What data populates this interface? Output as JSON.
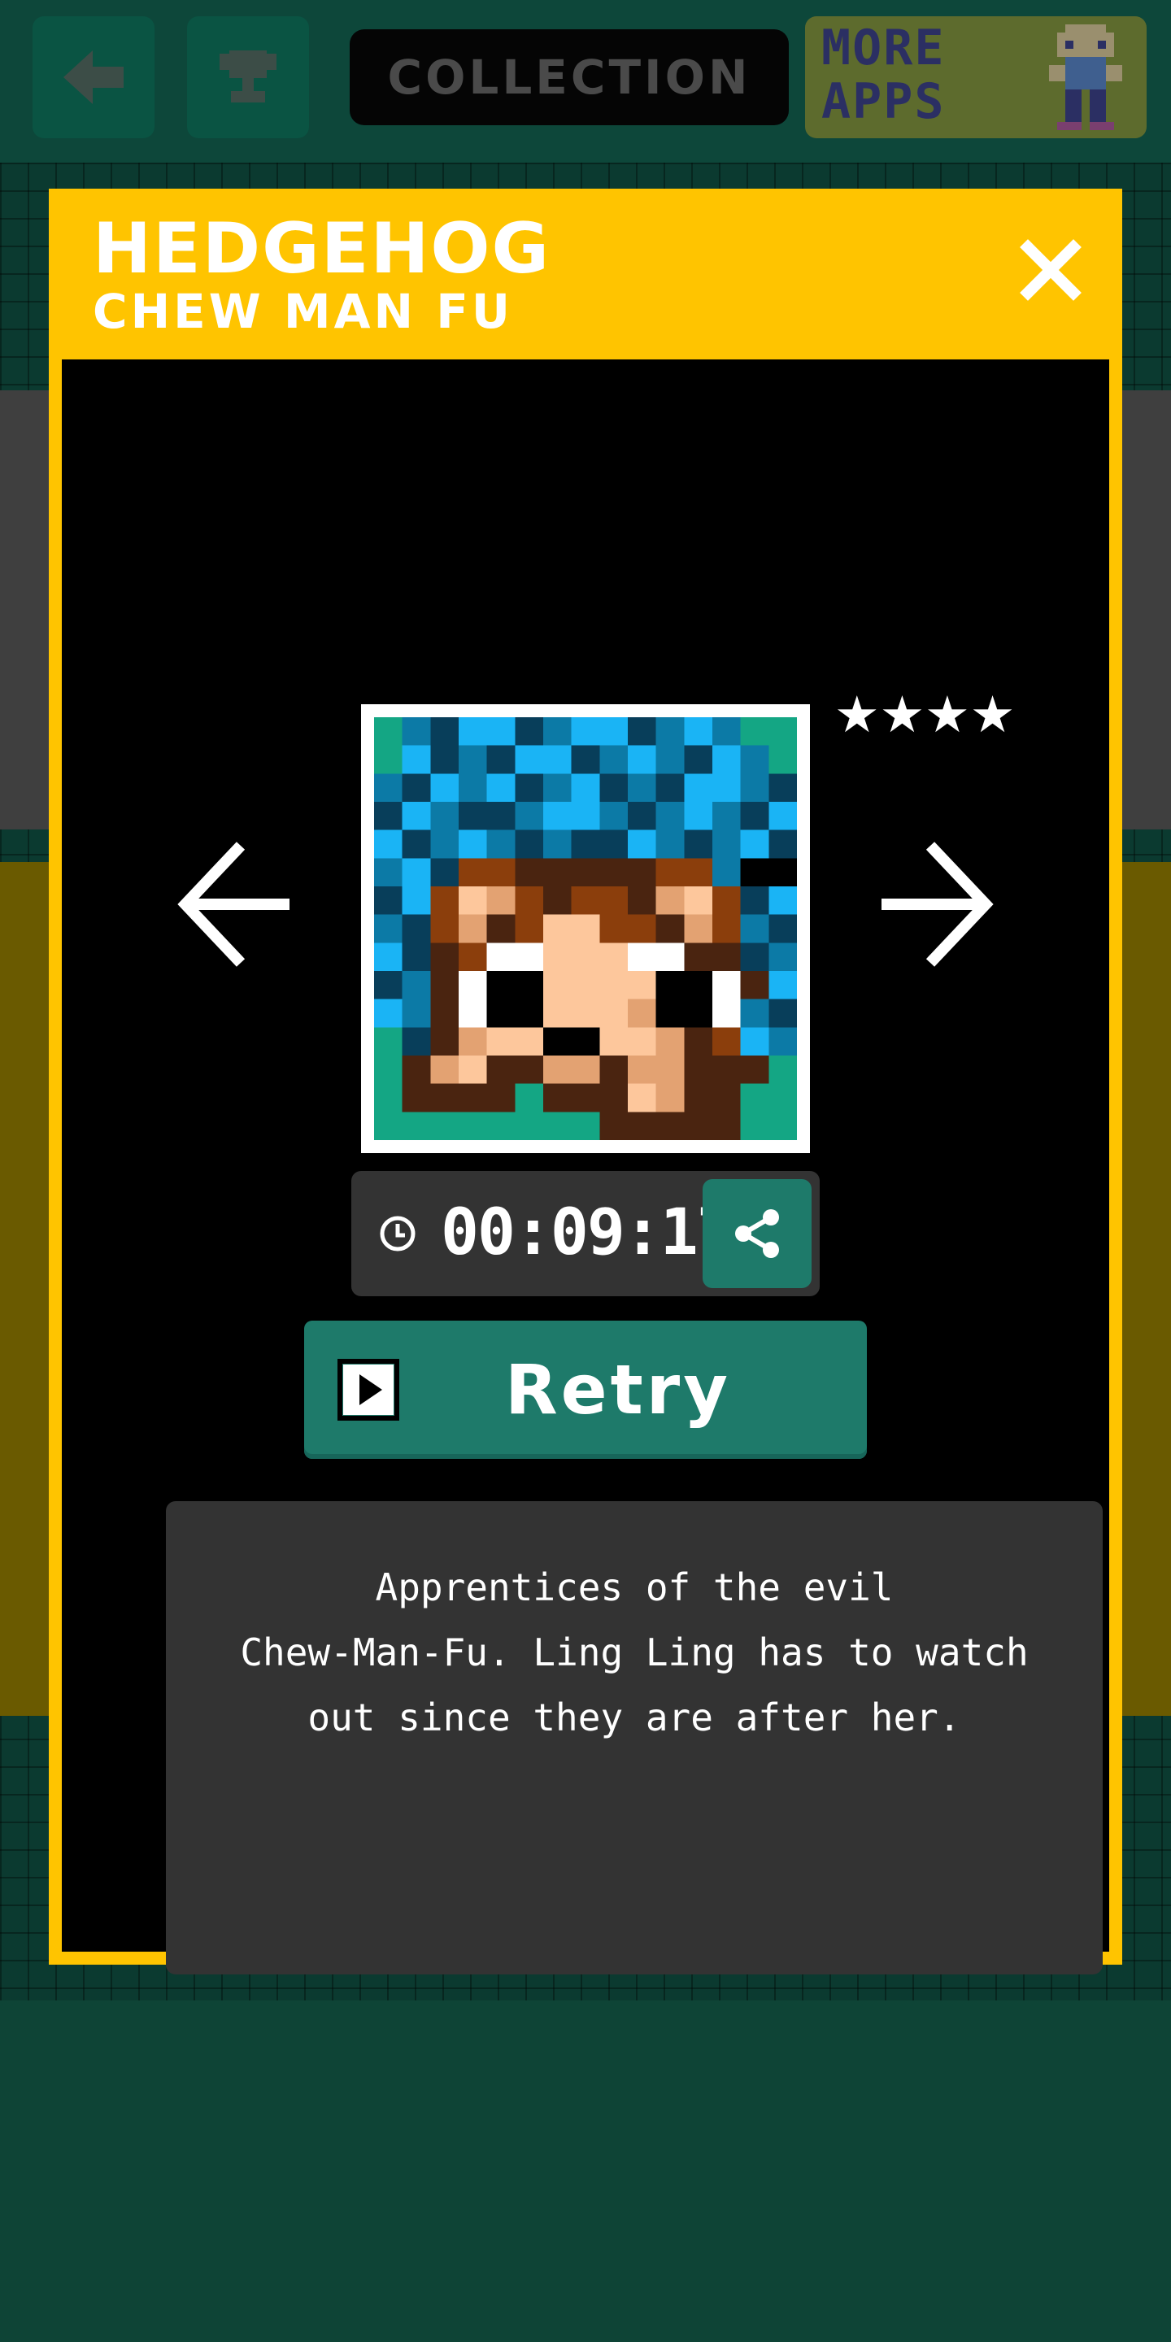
{
  "top_bar": {
    "back_icon": "arrow-left-icon",
    "trophy_icon": "trophy-icon",
    "title": "COLLECTION",
    "more_apps_line1": "MORE",
    "more_apps_line2": "APPS"
  },
  "modal": {
    "title": "HEDGEHOG",
    "subtitle": "CHEW MAN FU",
    "close_icon": "close-icon",
    "prev_icon": "arrow-left-icon",
    "next_icon": "arrow-right-icon",
    "stars": "★★★★",
    "rating": 4,
    "time": "00:09:17",
    "clock_icon": "clock-icon",
    "share_icon": "share-icon",
    "retry_label": "Retry",
    "retry_icon": "play-icon",
    "description": "Apprentices of the evil\nChew-Man-Fu. Ling Ling has to watch\nout since they are after her."
  },
  "colors": {
    "accent_yellow": "#ffc400",
    "button_teal": "#1e7a6a",
    "panel_gray": "#333333"
  }
}
